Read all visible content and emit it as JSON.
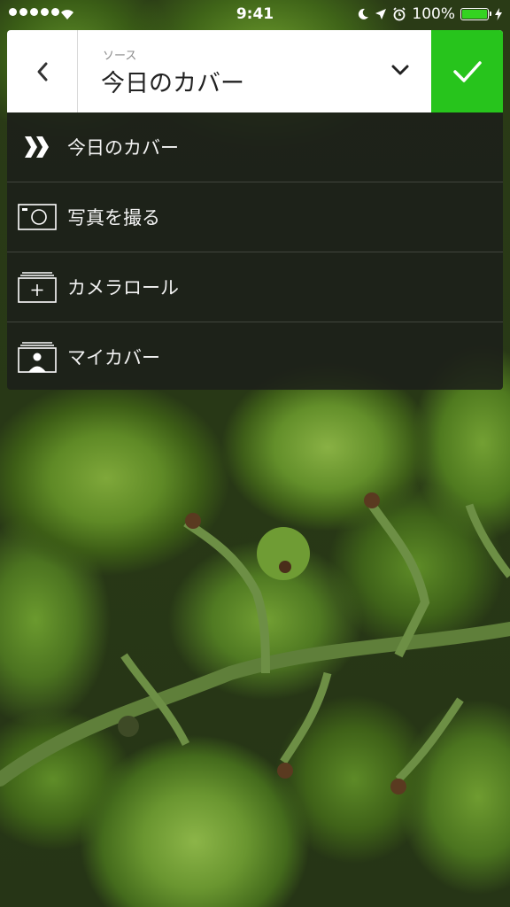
{
  "status_bar": {
    "time": "9:41",
    "battery_percent": "100%",
    "battery_level": 1.0,
    "signal_bars": 5
  },
  "header": {
    "source_label": "ソース",
    "source_value": "今日のカバー"
  },
  "colors": {
    "confirm_green": "#27c41c",
    "battery_green": "#34d321",
    "menu_background": "rgba(28,30,26,0.86)"
  },
  "menu": {
    "items": [
      {
        "label": "今日のカバー",
        "icon": "double-chevron-icon"
      },
      {
        "label": "写真を撮る",
        "icon": "camera-icon"
      },
      {
        "label": "カメラロール",
        "icon": "camera-roll-icon"
      },
      {
        "label": "マイカバー",
        "icon": "my-covers-icon"
      }
    ]
  }
}
